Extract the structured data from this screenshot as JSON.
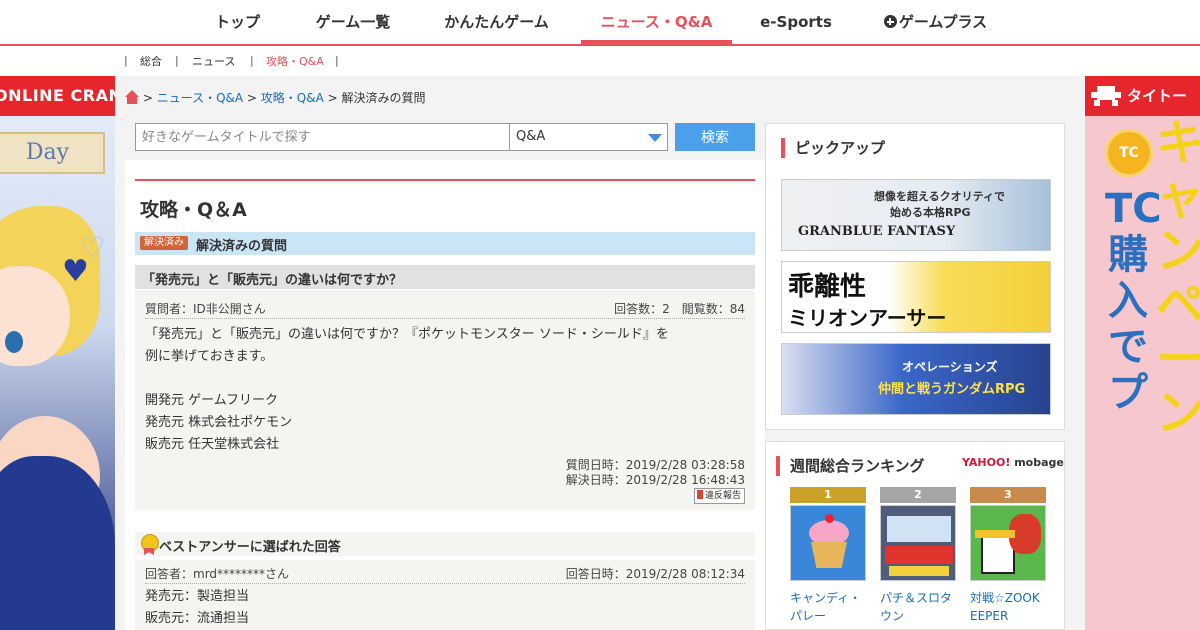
{
  "nav": {
    "items": [
      {
        "label": "トップ"
      },
      {
        "label": "ゲーム一覧"
      },
      {
        "label": "かんたんゲーム"
      },
      {
        "label": "ニュース・Q&A",
        "active": true
      },
      {
        "label": "e-Sports"
      },
      {
        "label": "ゲームプラス"
      }
    ]
  },
  "subnav": {
    "items": [
      "総合",
      "ニュース",
      "攻略・Q&A"
    ]
  },
  "breadcrumb": {
    "link1": "ニュース・Q&A",
    "link2": "攻略・Q&A",
    "current": "解決済みの質問"
  },
  "search": {
    "placeholder": "好きなゲームタイトルで探す",
    "category": "Q&A",
    "button": "検索"
  },
  "page": {
    "title": "攻略・Q＆A",
    "badge": "解決済み",
    "section": "解決済みの質問"
  },
  "question": {
    "title": "「発売元」と「販売元」の違いは何ですか？",
    "asker": "質問者：ID非公開さん",
    "stats": "回答数：2　閲覧数：84",
    "lines": [
      "「発売元」と「販売元」の違いは何ですか？『ポケットモンスター ソード・シールド』を",
      "例に挙げておきます。",
      "",
      "開発元 ゲームフリーク",
      "発売元 株式会社ポケモン",
      "販売元 任天堂株式会社"
    ],
    "asked_at": "質問日時：2019/2/28 03:28:58",
    "resolved_at": "解決日時：2019/2/28 16:48:43",
    "report": "違反報告"
  },
  "best_answer": {
    "heading": "ベストアンサーに選ばれた回答",
    "answerer": "回答者：mrd********さん",
    "answered_at": "回答日時：2019/2/28 08:12:34",
    "lines": [
      "発売元：製造担当",
      "販売元：流通担当"
    ]
  },
  "pickup": {
    "heading": "ピックアップ",
    "banners": [
      {
        "line1": "想像を超えるクオリティで",
        "line2": "始める本格RPG",
        "line3": "GRANBLUE FANTASY"
      },
      {
        "line1": "乖離性",
        "line2": "ミリオンアーサー"
      },
      {
        "line1": "オペレーションズ",
        "line2": "仲間と戦うガンダムRPG"
      }
    ]
  },
  "ranking": {
    "heading": "週間総合ランキング",
    "brand_yahoo": "YAHOO!",
    "brand_mobage": "mobage",
    "items": [
      {
        "rank": "1",
        "name": "キャンディ・パレー",
        "color": "#c9a227"
      },
      {
        "rank": "2",
        "name": "パチ＆スロタウン",
        "color": "#a5a5a5"
      },
      {
        "rank": "3",
        "name": "対戦☆ZOOKEEPER",
        "color": "#c98a4b"
      }
    ]
  },
  "ads": {
    "left_banner": "ONLINE CRANE",
    "left_ribbon": "Day",
    "right_banner": "タイトー",
    "right_coin": "TC",
    "right_text1": "TC購入でプ",
    "right_text2": "キャンペーン"
  },
  "colors": {
    "accent": "#e8515a",
    "link": "#1a6bb8",
    "search_button": "#4aa0ea"
  }
}
